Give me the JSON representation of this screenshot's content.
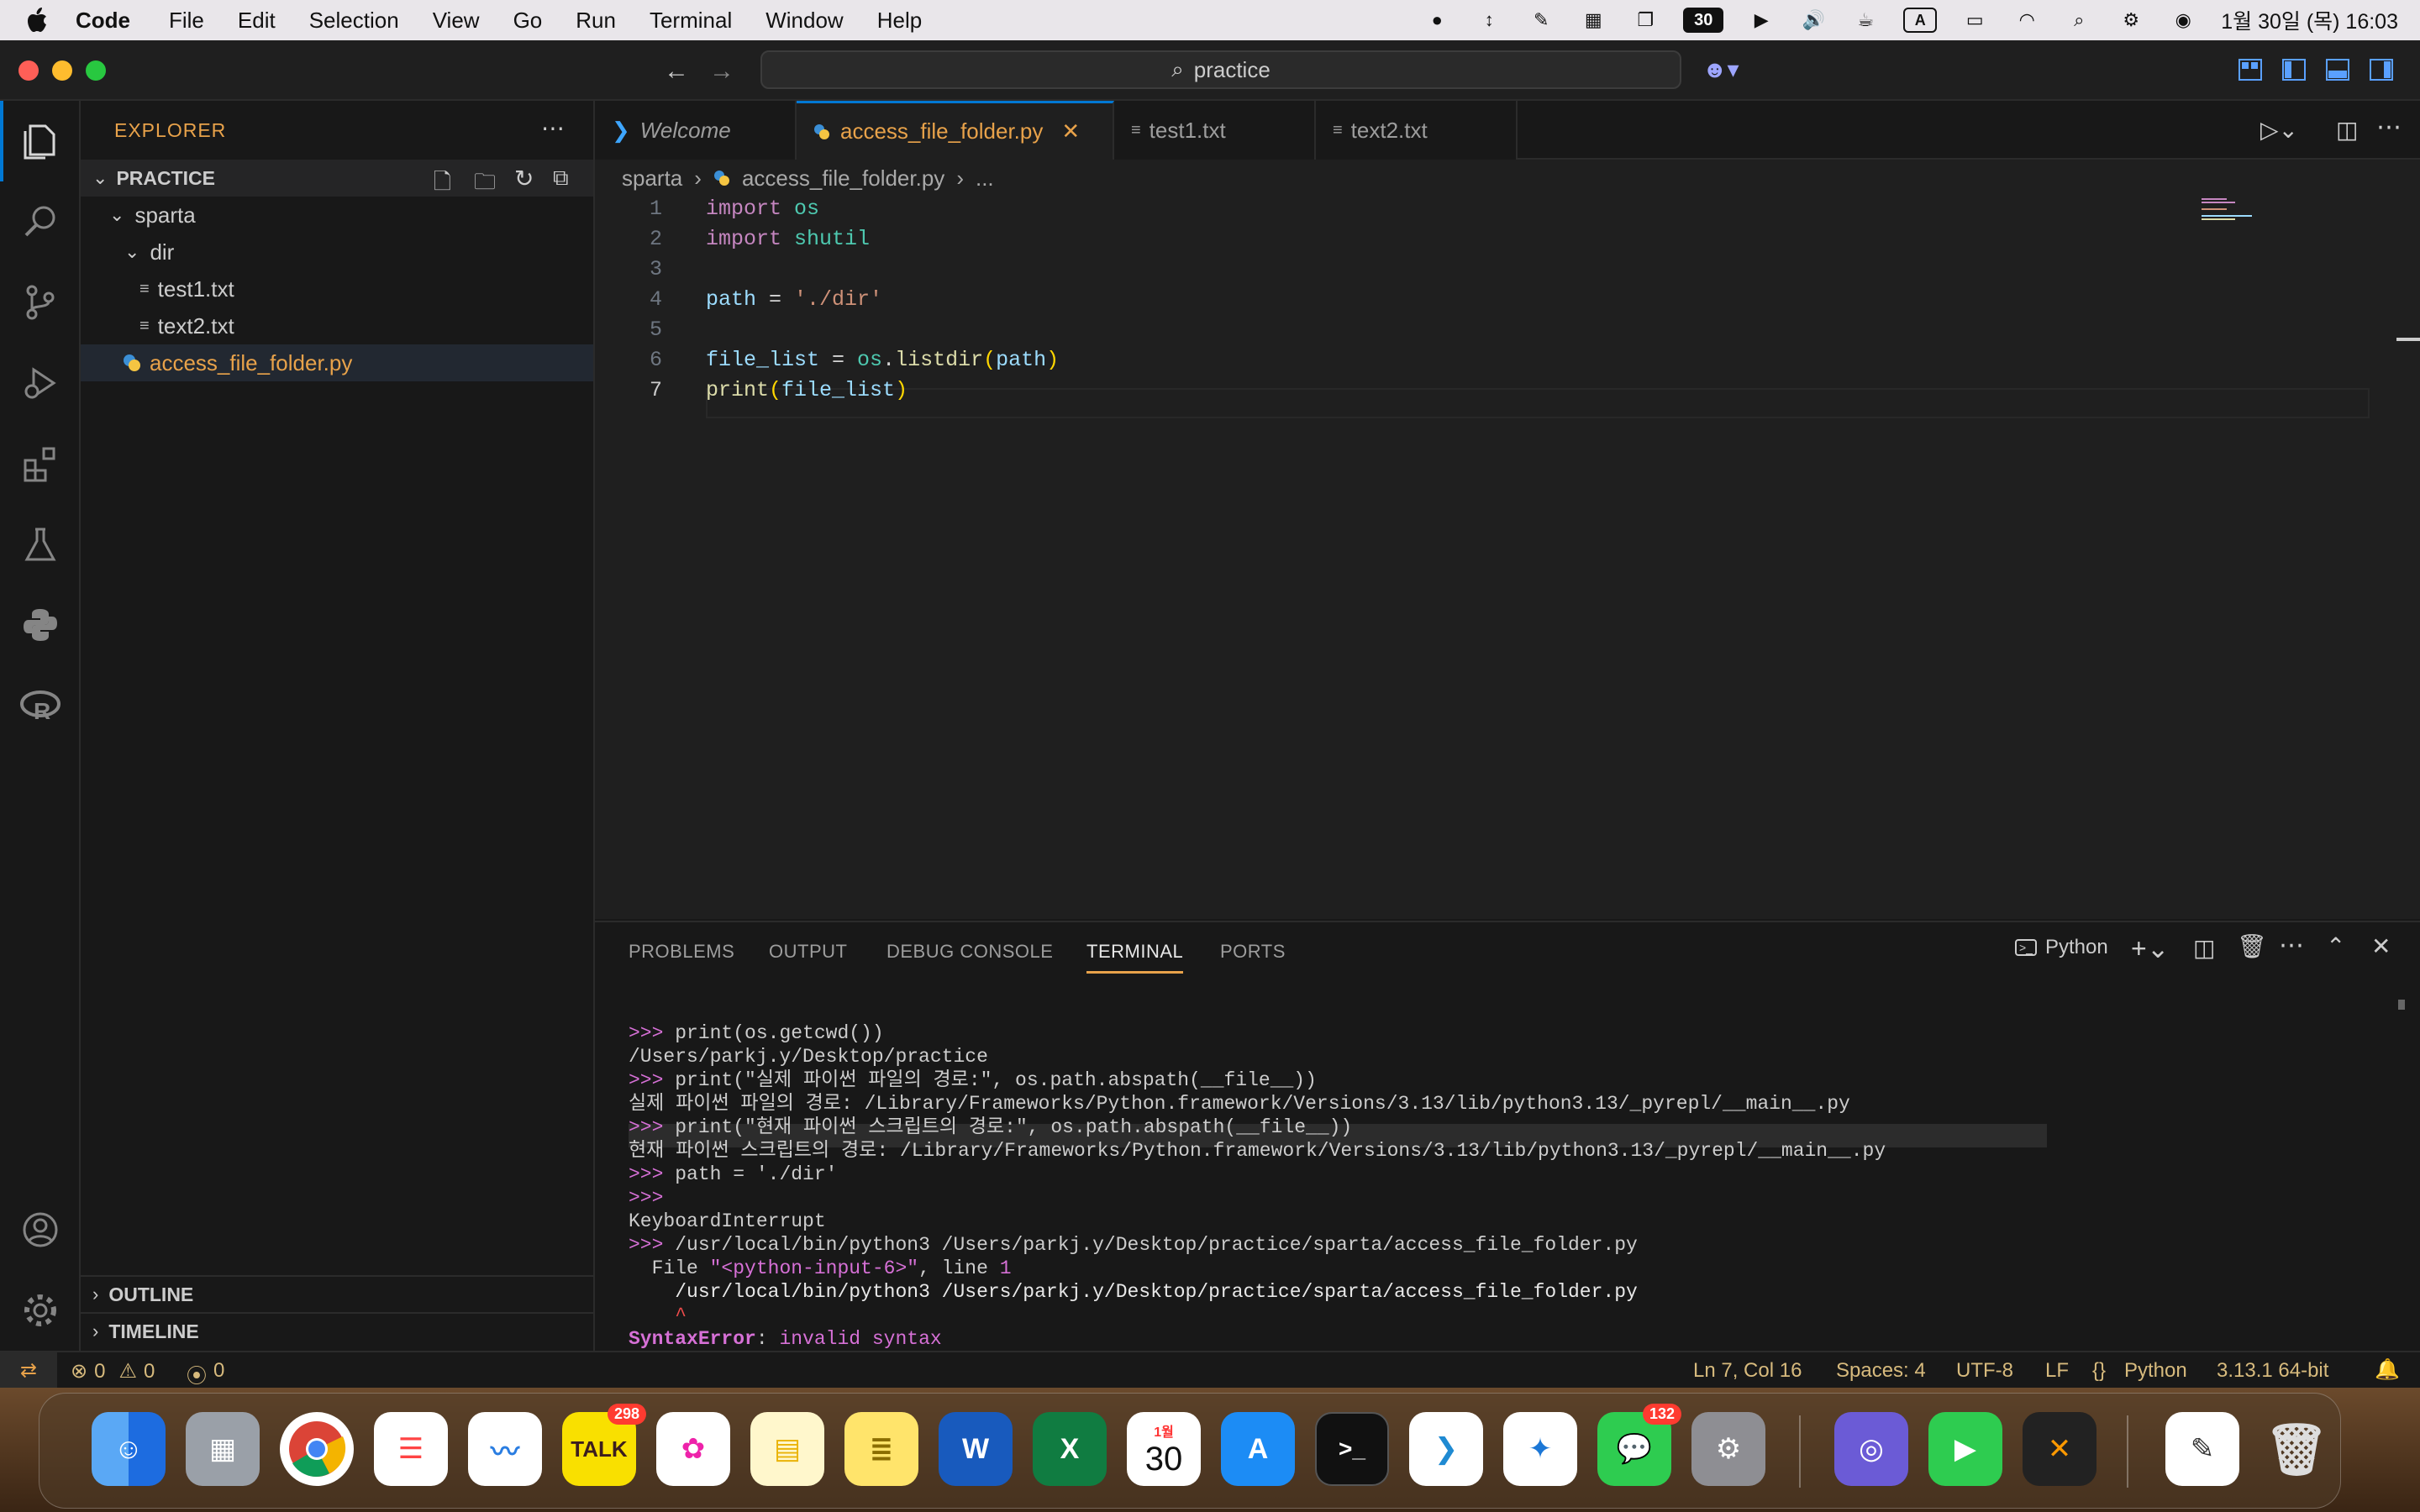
{
  "menubar": {
    "app": "Code",
    "items": [
      "File",
      "Edit",
      "Selection",
      "View",
      "Go",
      "Run",
      "Terminal",
      "Window",
      "Help"
    ],
    "tray_calendar": "30",
    "tray_input": "A",
    "datetime": "1월 30일 (목) 16:03"
  },
  "titlebar": {
    "search": "practice"
  },
  "sidebar": {
    "header": "EXPLORER",
    "root": "PRACTICE",
    "tree": [
      {
        "label": "sparta",
        "kind": "folder"
      },
      {
        "label": "dir",
        "kind": "folder"
      },
      {
        "label": "test1.txt",
        "kind": "file"
      },
      {
        "label": "text2.txt",
        "kind": "file"
      },
      {
        "label": "access_file_folder.py",
        "kind": "python"
      }
    ],
    "outline": "OUTLINE",
    "timeline": "TIMELINE"
  },
  "tabs": [
    {
      "label": "Welcome"
    },
    {
      "label": "access_file_folder.py"
    },
    {
      "label": "test1.txt"
    },
    {
      "label": "text2.txt"
    }
  ],
  "breadcrumb": [
    "sparta",
    "access_file_folder.py",
    "..."
  ],
  "editor": {
    "line_numbers": [
      "1",
      "2",
      "3",
      "4",
      "5",
      "6",
      "7"
    ],
    "current_line": 7
  },
  "panel": {
    "tabs": [
      "PROBLEMS",
      "OUTPUT",
      "DEBUG CONSOLE",
      "TERMINAL",
      "PORTS"
    ],
    "active_tab": "TERMINAL",
    "shell": "Python",
    "terminal_lines": [
      ">>> print(os.getcwd())",
      "/Users/parkj.y/Desktop/practice",
      ">>> print(\"실제 파이썬 파일의 경로:\", os.path.abspath(__file__))",
      "실제 파이썬 파일의 경로: /Library/Frameworks/Python.framework/Versions/3.13/lib/python3.13/_pyrepl/__main__.py",
      ">>> print(\"현재 파이썬 스크립트의 경로:\", os.path.abspath(__file__))",
      "현재 파이썬 스크립트의 경로: /Library/Frameworks/Python.framework/Versions/3.13/lib/python3.13/_pyrepl/__main__.py",
      ">>> path = './dir'",
      ">>>",
      "KeyboardInterrupt",
      ">>> /usr/local/bin/python3 /Users/parkj.y/Desktop/practice/sparta/access_file_folder.py",
      "  File \"<python-input-6>\", line 1",
      "    /usr/local/bin/python3 /Users/parkj.y/Desktop/practice/sparta/access_file_folder.py",
      "    ^",
      "SyntaxError: invalid syntax",
      ">>> "
    ]
  },
  "status": {
    "errors": "0",
    "warnings": "0",
    "ports": "0",
    "position": "Ln 7, Col 16",
    "spaces": "Spaces: 4",
    "encoding": "UTF-8",
    "eol": "LF",
    "language": "Python",
    "interpreter": "3.13.1 64-bit"
  },
  "dock": {
    "kakao_badge": "298",
    "calendar_month": "1월",
    "calendar_day": "30",
    "messages_badge": "132"
  },
  "colors": {
    "accent": "#0078d4",
    "modified_tab": "#e8a24a",
    "editor_bg": "#1f1f1f"
  }
}
